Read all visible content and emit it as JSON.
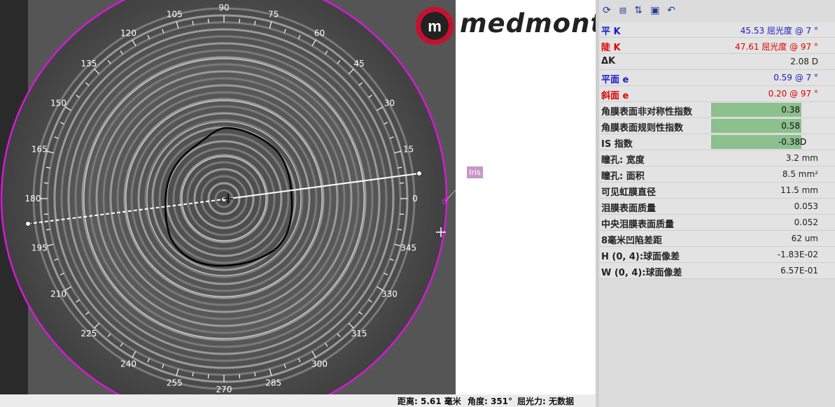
{
  "logo_text": "medmont",
  "iris_label": "Iris",
  "angles": [
    "0",
    "15",
    "30",
    "45",
    "60",
    "75",
    "90",
    "105",
    "120",
    "135",
    "150",
    "165",
    "180",
    "195",
    "210",
    "225",
    "240",
    "255",
    "270",
    "285",
    "300",
    "315",
    "330",
    "345"
  ],
  "status": {
    "distance": "距离: 5.61 毫米",
    "angle": "角度: 351°",
    "power": "屈光力: 无数据"
  },
  "toolbar": [
    "refresh-icon",
    "data-icon",
    "sort-icon",
    "save-icon",
    "undo-icon"
  ],
  "rows": [
    {
      "label": "平 K",
      "value": "45.53 屈光度 @ 7 °",
      "color": "blue"
    },
    {
      "label": "陡 K",
      "value": "47.61 屈光度 @ 97 °",
      "color": "red"
    },
    {
      "label": "ΔK",
      "value": "2.08 D",
      "color": "dark"
    },
    {
      "label": "平面 e",
      "value": "0.59 @ 7 °",
      "color": "blue"
    },
    {
      "label": "斜面 e",
      "value": "0.20 @ 97 °",
      "color": "red"
    },
    {
      "label": "角膜表面非对称性指数",
      "value": "0.38",
      "bar": true
    },
    {
      "label": "角膜表面规则性指数",
      "value": "0.58",
      "bar": true
    },
    {
      "label": "IS 指数",
      "value": "-0.38",
      "unit": "D",
      "bar": true
    },
    {
      "label": "瞳孔: 宽度",
      "value": "3.2 mm",
      "color": "dark"
    },
    {
      "label": "瞳孔: 面积",
      "value": "8.5 mm²",
      "color": "dark"
    },
    {
      "label": "可见虹膜直径",
      "value": "11.5 mm",
      "color": "dark"
    },
    {
      "label": "泪膜表面质量",
      "value": "0.053",
      "color": "dark"
    },
    {
      "label": "中央泪膜表面质量",
      "value": "0.052",
      "color": "dark"
    },
    {
      "label": "8毫米凹陷差距",
      "value": "62 um",
      "color": "dark"
    },
    {
      "label": "H (0, 4):球面像差",
      "value": "-1.83E-02",
      "color": "dark"
    },
    {
      "label": "W (0, 4):球面像差",
      "value": "6.57E-01",
      "color": "dark"
    }
  ]
}
